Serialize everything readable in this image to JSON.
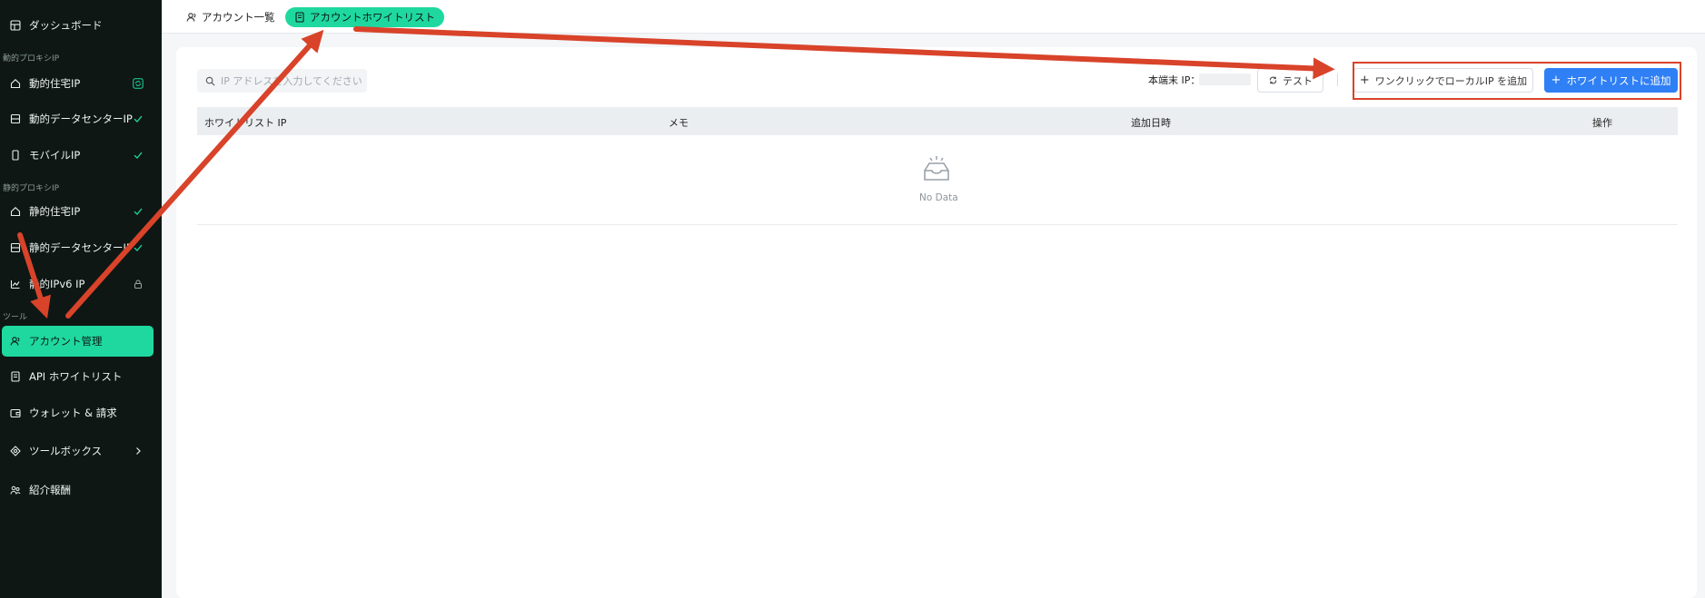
{
  "sidebar": {
    "items": [
      {
        "label": "ダッシュボード",
        "icon": "dashboard-icon"
      },
      {
        "label": "動的住宅IP",
        "icon": "home-icon",
        "badge_icon": "refresh-badge-icon"
      },
      {
        "label": "動的データセンターIP",
        "icon": "server-icon",
        "status": "check"
      },
      {
        "label": "モバイルIP",
        "icon": "mobile-icon",
        "status": "check"
      },
      {
        "label": "静的住宅IP",
        "icon": "home-icon",
        "status": "check"
      },
      {
        "label": "静的データセンターIP",
        "icon": "server-icon",
        "status": "check"
      },
      {
        "label": "静的IPv6 IP",
        "icon": "chart-icon",
        "status": "lock"
      },
      {
        "label": "アカウント管理",
        "icon": "user-icon",
        "active": true
      },
      {
        "label": "API ホワイトリスト",
        "icon": "document-icon"
      },
      {
        "label": "ウォレット & 請求",
        "icon": "wallet-icon"
      },
      {
        "label": "ツールボックス",
        "icon": "toolbox-icon",
        "chevron": true
      },
      {
        "label": "紹介報酬",
        "icon": "people-icon"
      }
    ],
    "sections": {
      "dynamic": "動的プロキシIP",
      "static": "静的プロキシIP",
      "tools": "ツール"
    }
  },
  "tabs": [
    {
      "label": "アカウント一覧",
      "icon": "user-icon"
    },
    {
      "label": "アカウントホワイトリスト",
      "icon": "document-icon",
      "active": true
    }
  ],
  "search": {
    "placeholder": "IP アドレスを入力してください"
  },
  "toolbar": {
    "ip_label": "本端末 IP：",
    "test_label": "テスト",
    "local_label": "ワンクリックでローカルIP を追加",
    "add_label": "ホワイトリストに追加"
  },
  "table": {
    "columns": [
      "ホワイトリスト IP",
      "メモ",
      "追加日時",
      "操作"
    ],
    "empty_text": "No Data"
  },
  "colors": {
    "sidebar_bg": "#0e1714",
    "accent": "#1fd8a0",
    "primary": "#2f7ff5",
    "annotation": "#d8432a"
  }
}
